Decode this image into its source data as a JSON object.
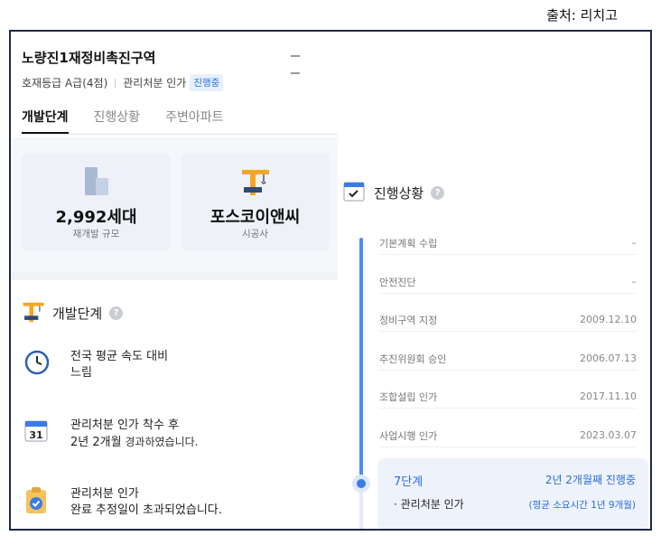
{
  "source": "출처: 리치고",
  "area": {
    "title": "노량진1재정비촉진구역",
    "grade": "호재등급 A급(4점)",
    "status": "관리처분 인가",
    "status_badge": "진행중"
  },
  "tabs": [
    {
      "label": "개발단계",
      "active": true
    },
    {
      "label": "진행상황",
      "active": false
    },
    {
      "label": "주변아파트",
      "active": false
    }
  ],
  "cards": [
    {
      "value": "2,992세대",
      "label": "재개발 규모",
      "icon": "building-icon"
    },
    {
      "value": "포스코이앤씨",
      "label": "시공사",
      "icon": "crane-icon"
    }
  ],
  "development": {
    "title": "개발단계",
    "items": [
      {
        "icon": "clock-icon",
        "line1": "전국 평균 속도 대비",
        "line2": "느림",
        "line2_suffix": ""
      },
      {
        "icon": "calendar-icon",
        "line1": "관리처분 인가 착수 후",
        "line2": "2년 2개월",
        "line2_suffix": " 경과하였습니다."
      },
      {
        "icon": "clipboard-check-icon",
        "line1": "관리처분 인가",
        "line2": "완료 추정일이 초과되었습니다.",
        "line2_suffix": ""
      }
    ],
    "calendar_day": "31"
  },
  "progress": {
    "title": "진행상황",
    "steps": [
      {
        "name": "기본계획 수립",
        "date": "–"
      },
      {
        "name": "안전진단",
        "date": "–"
      },
      {
        "name": "정비구역 지정",
        "date": "2009.12.10"
      },
      {
        "name": "추진위원회 승인",
        "date": "2006.07.13"
      },
      {
        "name": "조합설립 인가",
        "date": "2017.11.10"
      },
      {
        "name": "사업시행 인가",
        "date": "2023.03.07"
      }
    ],
    "current": {
      "stage": "7단계",
      "elapsed": "2년 2개월째 진행중",
      "name": "· 관리처분 인가",
      "avg": "(평균 소요시간 1년 9개월)"
    }
  },
  "colors": {
    "accent": "#3b7be8",
    "frame": "#1d2a44",
    "crane": "#f5a623"
  }
}
